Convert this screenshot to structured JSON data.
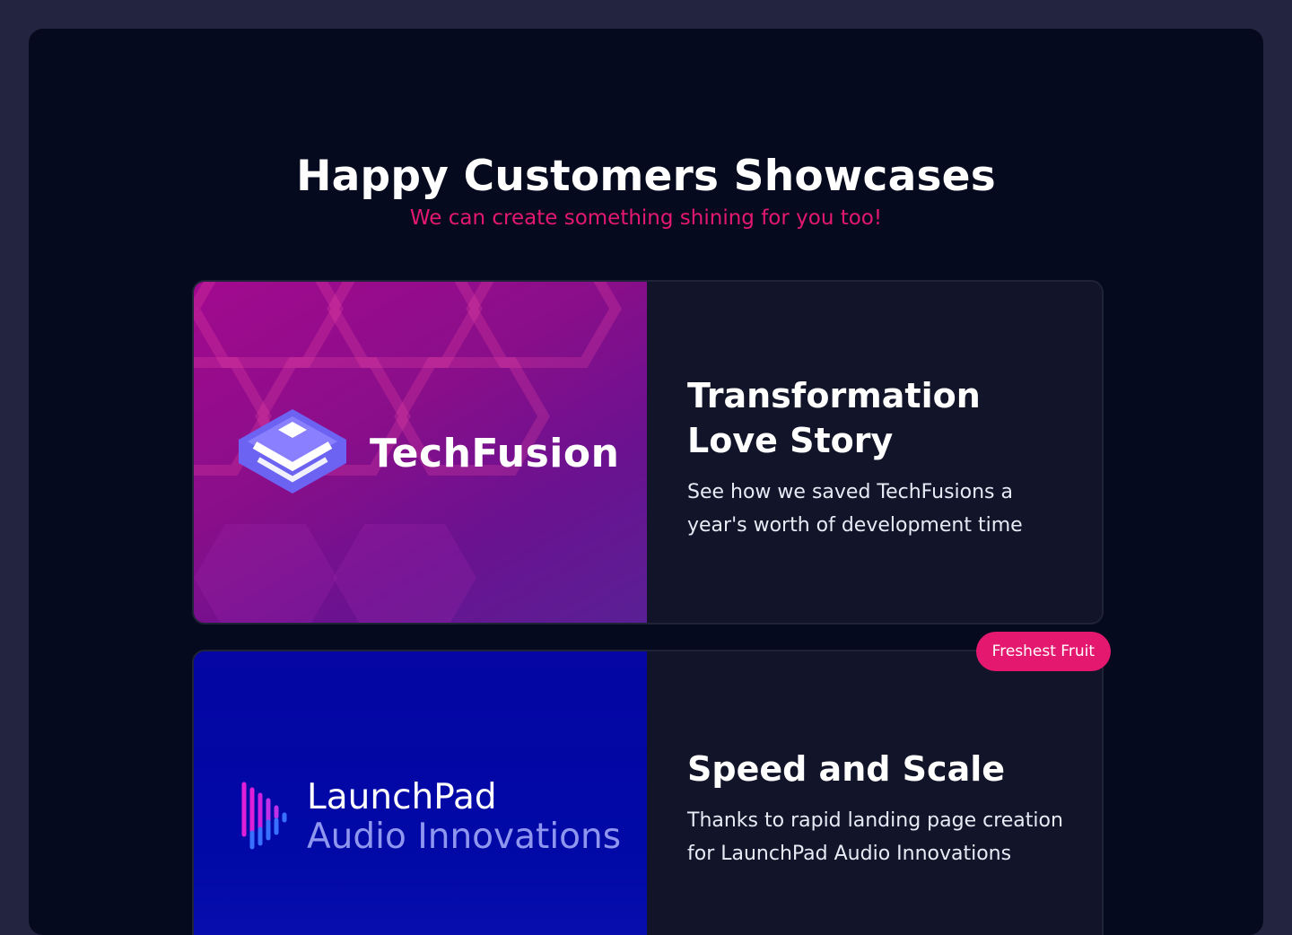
{
  "header": {
    "title": "Happy Customers Showcases",
    "subtitle": "We can create something shining for you too!"
  },
  "showcases": [
    {
      "brand": "TechFusion",
      "logo_icon": "layered-cube-icon",
      "title": "Transformation Love Story",
      "description": "See how we saved TechFusions a year's worth of development time",
      "colors": {
        "brand": "#a20a8e",
        "logo": "#7b6cf6"
      }
    },
    {
      "brand": "LaunchPad",
      "brand_sub": "Audio Innovations",
      "logo_icon": "audio-waveform-icon",
      "badge": "Freshest Fruit",
      "title": "Speed and Scale",
      "description": "Thanks to rapid landing page creation for LaunchPad Audio Innovations",
      "colors": {
        "brand": "#0506a4",
        "accent": "#e5186f"
      }
    }
  ],
  "colors": {
    "page_bg": "#222440",
    "frame_bg": "#050a1e",
    "card_bg": "#12152a",
    "accent": "#e5186f"
  }
}
